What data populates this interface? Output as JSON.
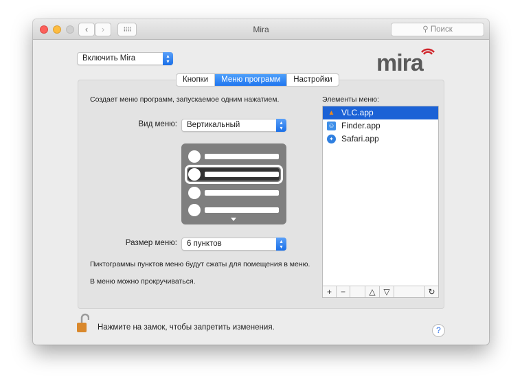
{
  "window": {
    "title": "Mira",
    "search_placeholder": "Поиск",
    "search_icon": "magnifier-icon"
  },
  "colors": {
    "accent": "#1f75ef",
    "selection": "#1b62d6",
    "logo_red": "#d0262c",
    "logo_gray": "#5a5a5a"
  },
  "enable_popup": {
    "value": "Включить Mira"
  },
  "logo": {
    "text": "mira"
  },
  "tabs": [
    {
      "label": "Кнопки"
    },
    {
      "label": "Меню программ",
      "selected": true
    },
    {
      "label": "Настройки"
    }
  ],
  "panel": {
    "description": "Создает меню программ, запускаемое одним нажатием.",
    "menu_type_label": "Вид меню:",
    "menu_type_value": "Вертикальный",
    "menu_size_label": "Размер меню:",
    "menu_size_value": "6 пунктов",
    "note1": "Пиктограммы пунктов меню будут сжаты для помещения в меню.",
    "note2": "В меню можно прокручиваться.",
    "list_label": "Элементы меню:",
    "items": [
      {
        "label": "VLC.app",
        "icon": "vlc-icon",
        "selected": true
      },
      {
        "label": "Finder.app",
        "icon": "finder-icon"
      },
      {
        "label": "Safari.app",
        "icon": "safari-icon"
      }
    ],
    "toolbar": {
      "add": "+",
      "remove": "−",
      "up": "△",
      "down": "▽",
      "refresh": "↻"
    }
  },
  "footer": {
    "lock_text": "Нажмите на замок, чтобы запретить изменения.",
    "help": "?"
  }
}
